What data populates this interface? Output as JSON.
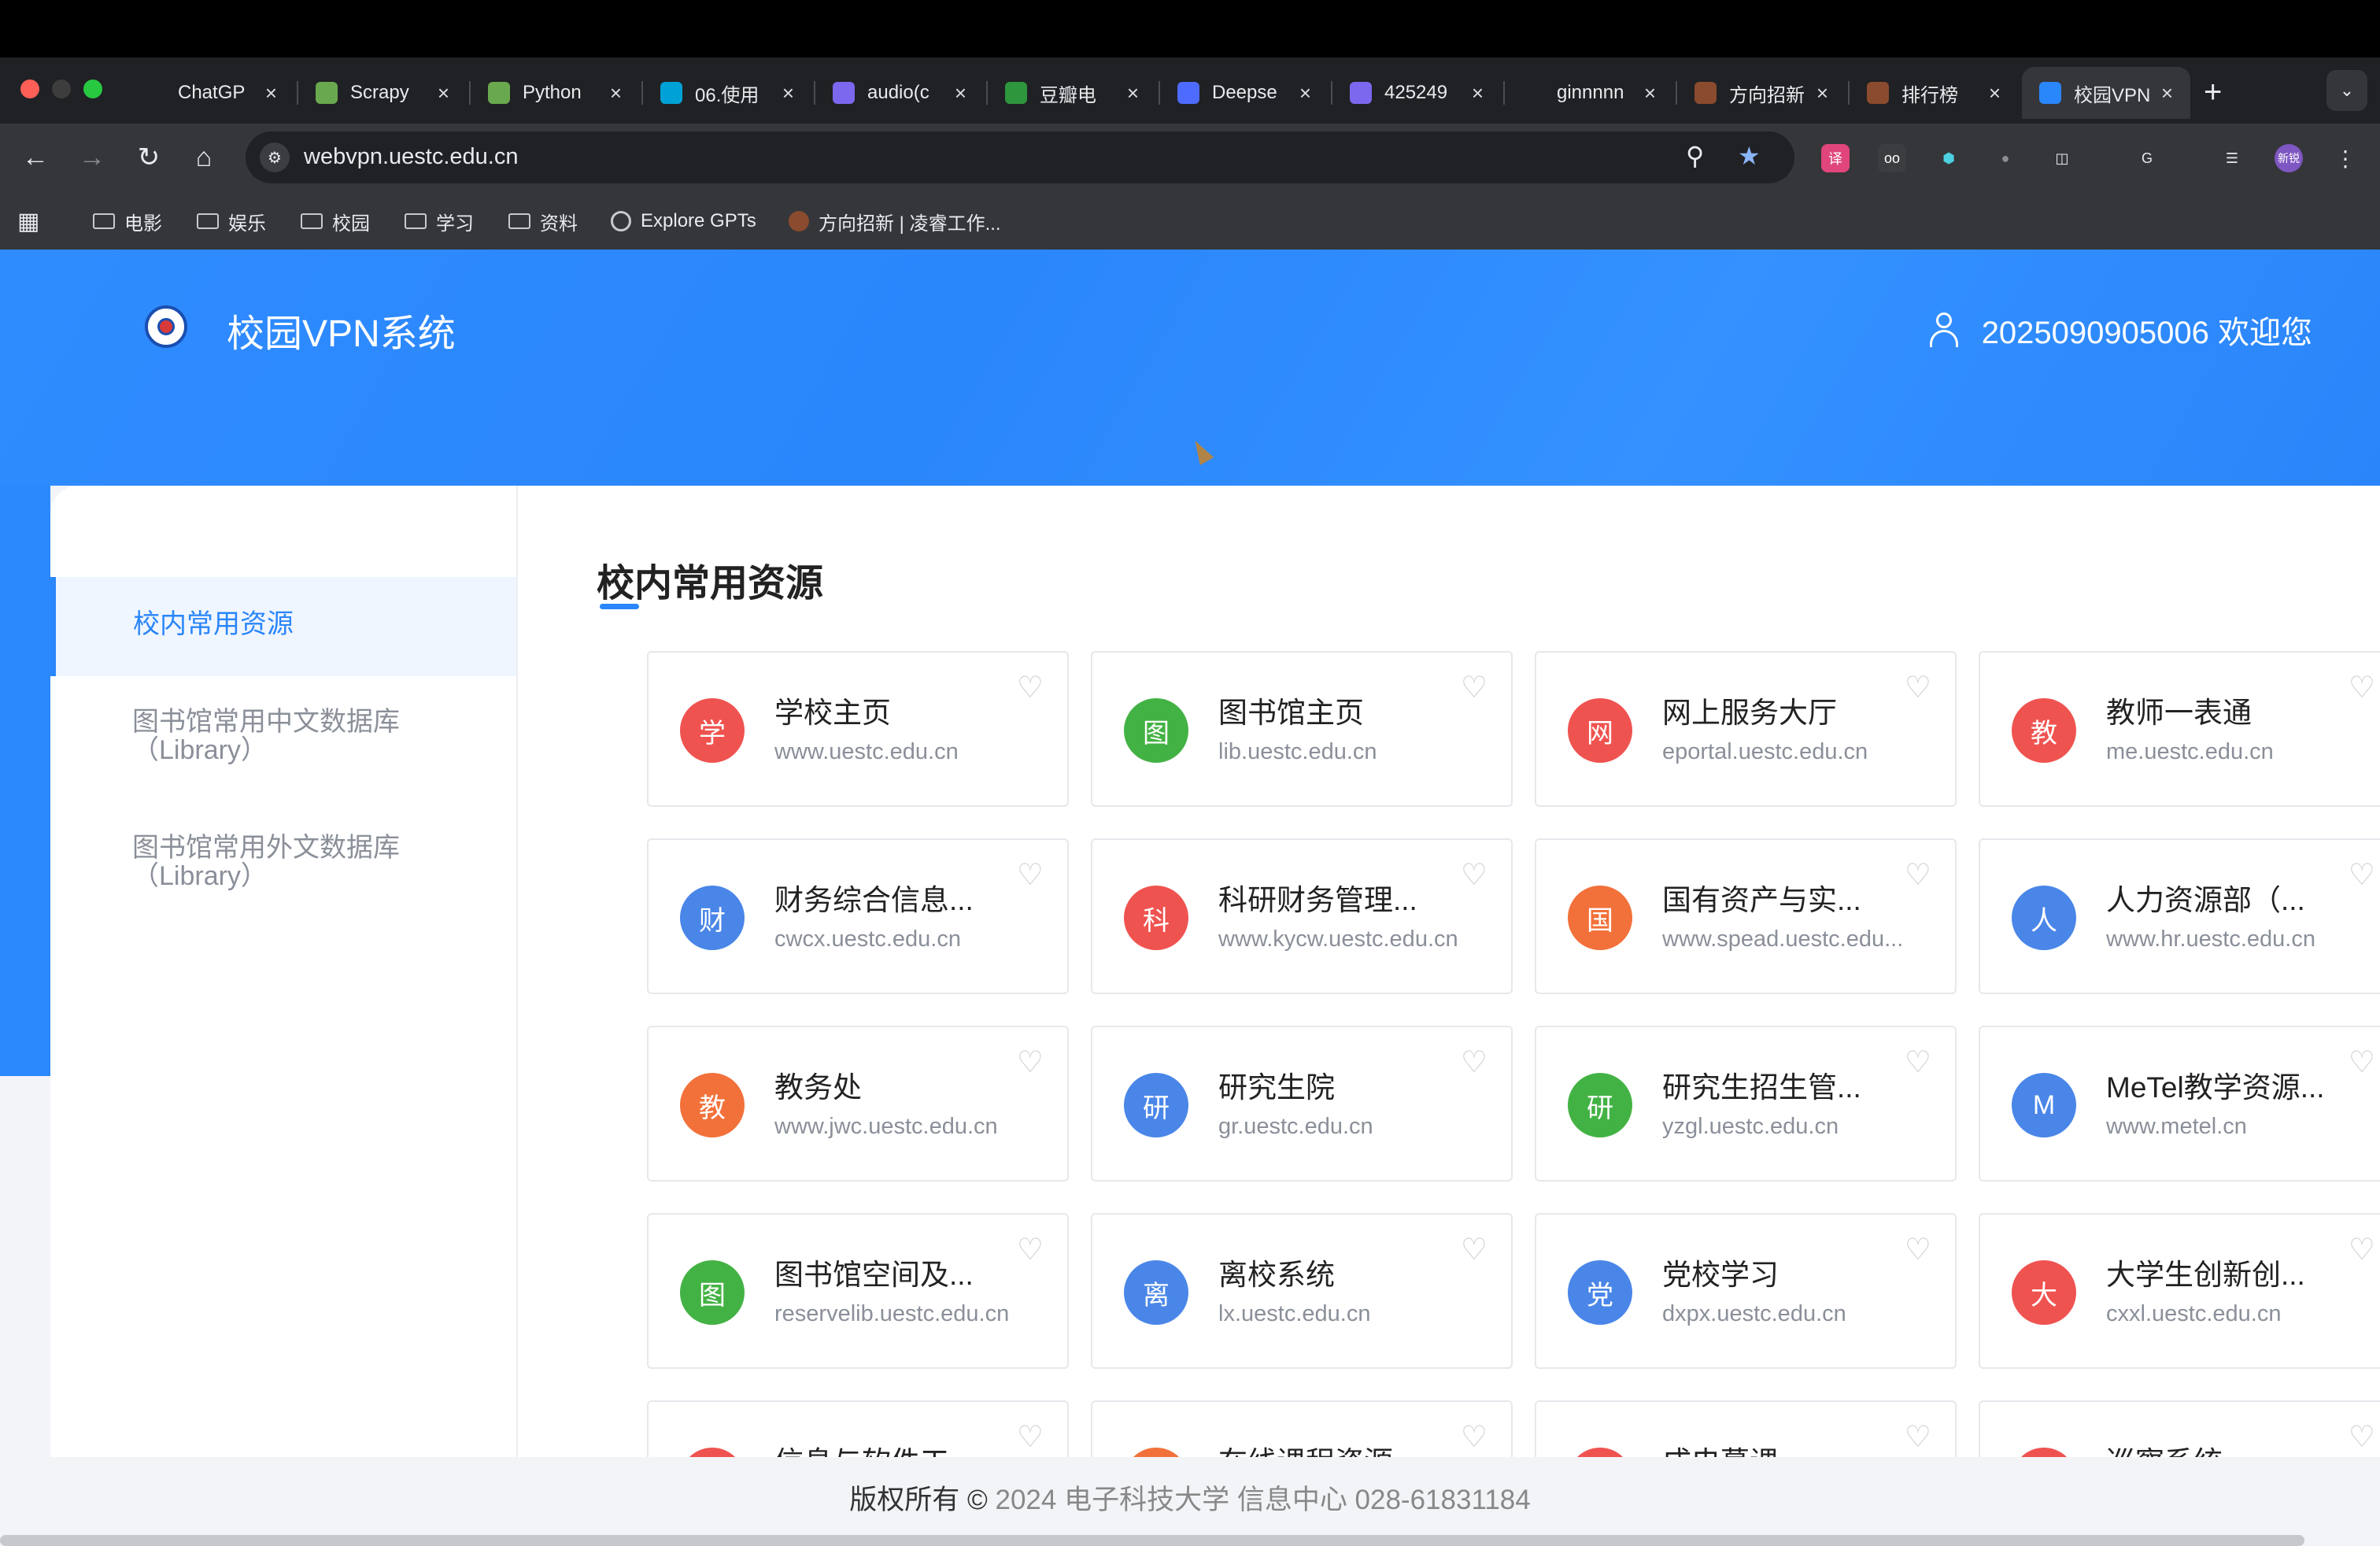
{
  "browser": {
    "tabs": [
      {
        "label": "ChatGP",
        "icon": "openai-icon",
        "color": "#202124"
      },
      {
        "label": "Scrapy",
        "icon": "scrapy-icon",
        "color": "#6aa84f"
      },
      {
        "label": "Python",
        "icon": "python-icon",
        "color": "#6aa84f"
      },
      {
        "label": "06.使用",
        "icon": "bilibili-icon",
        "color": "#00a1d6"
      },
      {
        "label": "audio(c",
        "icon": "app-icon",
        "color": "#7b68ee"
      },
      {
        "label": "豆瓣电",
        "icon": "douban-icon",
        "color": "#2e963d"
      },
      {
        "label": "Deepse",
        "icon": "deepseek-icon",
        "color": "#4d6bfe"
      },
      {
        "label": "425249",
        "icon": "app-icon",
        "color": "#7b68ee"
      },
      {
        "label": "ginnnnn",
        "icon": "github-icon",
        "color": "#202124"
      },
      {
        "label": "方向招新",
        "icon": "circle-avatar-icon",
        "color": "#8a4b2e"
      },
      {
        "label": "排行榜",
        "icon": "circle-avatar-icon",
        "color": "#8a4b2e"
      },
      {
        "label": "校园VPN",
        "icon": "vpn-icon",
        "color": "#2a86fb"
      }
    ],
    "url": "webvpn.uestc.edu.cn",
    "bookmarks": {
      "folders": [
        "电影",
        "娱乐",
        "校园",
        "学习",
        "资料"
      ],
      "explore": "Explore GPTs",
      "fangxiang": "方向招新 | 凌睿工作..."
    },
    "profile_label": "新锐"
  },
  "header": {
    "brand": "校园VPN系统",
    "user": "2025090905006 欢迎您"
  },
  "sidebar": {
    "items": [
      {
        "label": "校内常用资源"
      },
      {
        "label": "图书馆常用中文数据库",
        "sub": "（Library）"
      },
      {
        "label": "图书馆常用外文数据库",
        "sub": "（Library）"
      }
    ]
  },
  "main": {
    "title": "校内常用资源",
    "cards": [
      {
        "icon": "学",
        "name": "学校主页",
        "url": "www.uestc.edu.cn",
        "color": "#ef5350"
      },
      {
        "icon": "图",
        "name": "图书馆主页",
        "url": "lib.uestc.edu.cn",
        "color": "#43b244"
      },
      {
        "icon": "网",
        "name": "网上服务大厅",
        "url": "eportal.uestc.edu.cn",
        "color": "#ef5350"
      },
      {
        "icon": "教",
        "name": "教师一表通",
        "url": "me.uestc.edu.cn",
        "color": "#ef5350"
      },
      {
        "icon": "财",
        "name": "财务综合信息...",
        "url": "cwcx.uestc.edu.cn",
        "color": "#4a86e8"
      },
      {
        "icon": "科",
        "name": "科研财务管理...",
        "url": "www.kycw.uestc.edu.cn",
        "color": "#ef5350"
      },
      {
        "icon": "国",
        "name": "国有资产与实...",
        "url": "www.spead.uestc.edu...",
        "color": "#f2713a"
      },
      {
        "icon": "人",
        "name": "人力资源部（...",
        "url": "www.hr.uestc.edu.cn",
        "color": "#4a86e8"
      },
      {
        "icon": "教",
        "name": "教务处",
        "url": "www.jwc.uestc.edu.cn",
        "color": "#f2713a"
      },
      {
        "icon": "研",
        "name": "研究生院",
        "url": "gr.uestc.edu.cn",
        "color": "#4a86e8"
      },
      {
        "icon": "研",
        "name": "研究生招生管...",
        "url": "yzgl.uestc.edu.cn",
        "color": "#43b244"
      },
      {
        "icon": "M",
        "name": "MeTel教学资源...",
        "url": "www.metel.cn",
        "color": "#4a86e8"
      },
      {
        "icon": "图",
        "name": "图书馆空间及...",
        "url": "reservelib.uestc.edu.cn",
        "color": "#43b244"
      },
      {
        "icon": "离",
        "name": "离校系统",
        "url": "lx.uestc.edu.cn",
        "color": "#4a86e8"
      },
      {
        "icon": "党",
        "name": "党校学习",
        "url": "dxpx.uestc.edu.cn",
        "color": "#4a86e8"
      },
      {
        "icon": "大",
        "name": "大学生创新创...",
        "url": "cxxl.uestc.edu.cn",
        "color": "#ef5350"
      },
      {
        "icon": "",
        "name": "信息与软件工",
        "url": "",
        "color": "#ef5350"
      },
      {
        "icon": "",
        "name": "在线课程资源",
        "url": "",
        "color": "#f2713a"
      },
      {
        "icon": "",
        "name": "成电慕课",
        "url": "",
        "color": "#ef5350"
      },
      {
        "icon": "",
        "name": "巡察系统",
        "url": "",
        "color": "#ef5350"
      }
    ]
  },
  "footer": {
    "prefix": "版权所有 ©",
    "text": " 2024 电子科技大学 信息中心 028-61831184"
  }
}
